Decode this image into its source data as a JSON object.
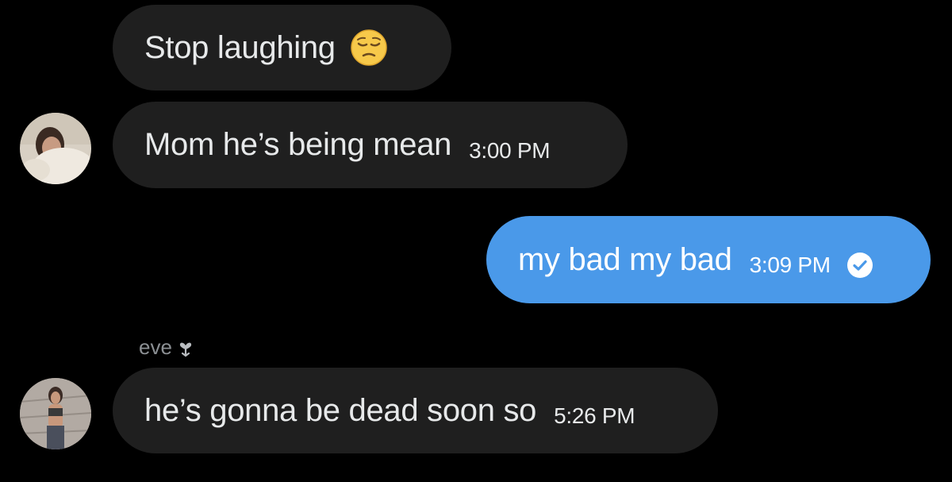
{
  "colors": {
    "background": "#000000",
    "incoming_bubble": "#1f1f1f",
    "outgoing_bubble": "#4a99e9",
    "text": "#e7e9ea",
    "sender_name": "#8b8f93"
  },
  "messages": [
    {
      "direction": "incoming",
      "text": "Stop laughing",
      "emoji": "pensive-face-emoji"
    },
    {
      "direction": "incoming",
      "text": "Mom he’s being mean",
      "time": "3:00 PM"
    },
    {
      "direction": "outgoing",
      "text": "my bad my bad",
      "time": "3:09 PM",
      "status_icon": "read-check-icon"
    },
    {
      "direction": "incoming",
      "sender": "eve",
      "sender_icon": "heart-emoji",
      "text": "he’s gonna be dead soon so",
      "time": "5:26 PM"
    }
  ]
}
